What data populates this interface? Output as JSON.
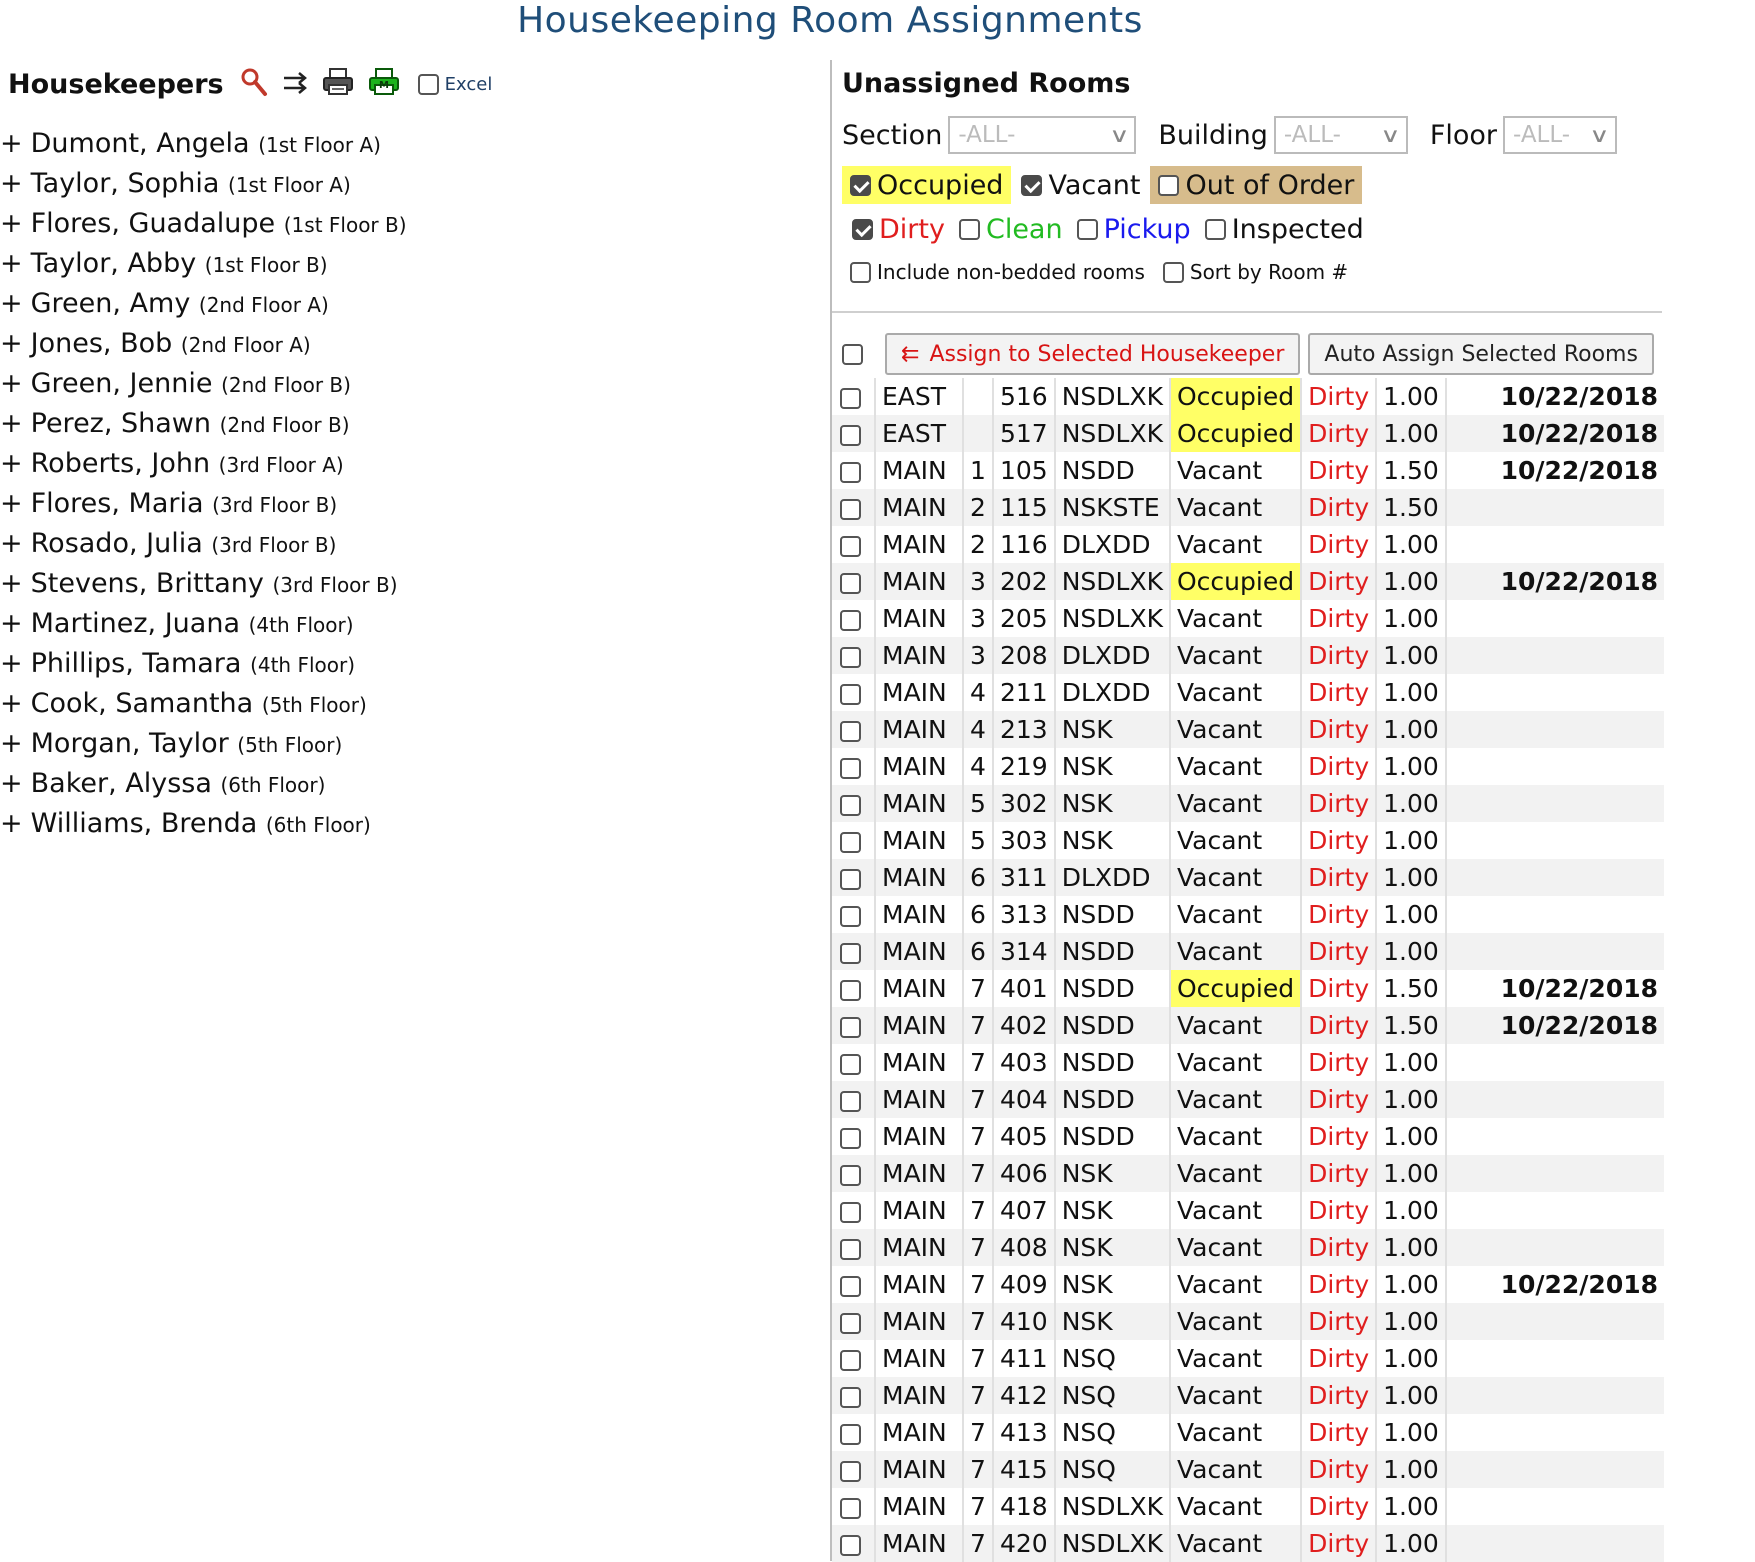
{
  "page_title": "Housekeeping Room Assignments",
  "housekeepers_panel": {
    "title": "Housekeepers",
    "icons": [
      "search-icon",
      "transfer-icon",
      "print-icon",
      "excel-print-icon"
    ],
    "excel_label": "Excel",
    "excel_checked": false,
    "items": [
      {
        "name": "Dumont, Angela",
        "area": "(1st Floor A)"
      },
      {
        "name": "Taylor, Sophia",
        "area": "(1st Floor A)"
      },
      {
        "name": "Flores, Guadalupe",
        "area": "(1st Floor B)"
      },
      {
        "name": "Taylor, Abby",
        "area": "(1st Floor B)"
      },
      {
        "name": "Green, Amy",
        "area": "(2nd Floor A)"
      },
      {
        "name": "Jones, Bob",
        "area": "(2nd Floor A)"
      },
      {
        "name": "Green, Jennie",
        "area": "(2nd Floor B)"
      },
      {
        "name": "Perez, Shawn",
        "area": "(2nd Floor B)"
      },
      {
        "name": "Roberts, John",
        "area": "(3rd Floor A)"
      },
      {
        "name": "Flores, Maria",
        "area": "(3rd Floor B)"
      },
      {
        "name": "Rosado, Julia",
        "area": "(3rd Floor B)"
      },
      {
        "name": "Stevens, Brittany",
        "area": "(3rd Floor B)"
      },
      {
        "name": "Martinez, Juana",
        "area": "(4th Floor)"
      },
      {
        "name": "Phillips, Tamara",
        "area": "(4th Floor)"
      },
      {
        "name": "Cook, Samantha",
        "area": "(5th Floor)"
      },
      {
        "name": "Morgan, Taylor",
        "area": "(5th Floor)"
      },
      {
        "name": "Baker, Alyssa",
        "area": "(6th Floor)"
      },
      {
        "name": "Williams, Brenda",
        "area": "(6th Floor)"
      }
    ]
  },
  "unassigned_panel": {
    "title": "Unassigned Rooms",
    "filters": {
      "section_label": "Section",
      "section_value": "-ALL-",
      "building_label": "Building",
      "building_value": "-ALL-",
      "floor_label": "Floor",
      "floor_value": "-ALL-"
    },
    "status_filters": {
      "occupied": {
        "label": "Occupied",
        "checked": true,
        "bg": "#ffff66"
      },
      "vacant": {
        "label": "Vacant",
        "checked": true
      },
      "out_of_order": {
        "label": "Out of Order",
        "checked": false,
        "bg": "#d7bc8c"
      }
    },
    "condition_filters": {
      "dirty": {
        "label": "Dirty",
        "checked": true,
        "color": "#e01e1e"
      },
      "clean": {
        "label": "Clean",
        "checked": false,
        "color": "#22bb22"
      },
      "pickup": {
        "label": "Pickup",
        "checked": false,
        "color": "#1a1aee"
      },
      "inspected": {
        "label": "Inspected",
        "checked": false
      }
    },
    "options": {
      "non_bedded": "Include non-bedded rooms",
      "sort_by_room": "Sort by Room #"
    },
    "buttons": {
      "assign_arrow": "⇇",
      "assign": "Assign to Selected Housekeeper",
      "auto_assign": "Auto Assign Selected Rooms"
    },
    "rooms": [
      {
        "section": "EAST",
        "floor": "",
        "room": "516",
        "type": "NSDLXK",
        "status": "Occupied",
        "condition": "Dirty",
        "credits": "1.00",
        "date": "10/22/2018"
      },
      {
        "section": "EAST",
        "floor": "",
        "room": "517",
        "type": "NSDLXK",
        "status": "Occupied",
        "condition": "Dirty",
        "credits": "1.00",
        "date": "10/22/2018"
      },
      {
        "section": "MAIN",
        "floor": "1",
        "room": "105",
        "type": "NSDD",
        "status": "Vacant",
        "condition": "Dirty",
        "credits": "1.50",
        "date": "10/22/2018"
      },
      {
        "section": "MAIN",
        "floor": "2",
        "room": "115",
        "type": "NSKSTE",
        "status": "Vacant",
        "condition": "Dirty",
        "credits": "1.50",
        "date": ""
      },
      {
        "section": "MAIN",
        "floor": "2",
        "room": "116",
        "type": "DLXDD",
        "status": "Vacant",
        "condition": "Dirty",
        "credits": "1.00",
        "date": ""
      },
      {
        "section": "MAIN",
        "floor": "3",
        "room": "202",
        "type": "NSDLXK",
        "status": "Occupied",
        "condition": "Dirty",
        "credits": "1.00",
        "date": "10/22/2018"
      },
      {
        "section": "MAIN",
        "floor": "3",
        "room": "205",
        "type": "NSDLXK",
        "status": "Vacant",
        "condition": "Dirty",
        "credits": "1.00",
        "date": ""
      },
      {
        "section": "MAIN",
        "floor": "3",
        "room": "208",
        "type": "DLXDD",
        "status": "Vacant",
        "condition": "Dirty",
        "credits": "1.00",
        "date": ""
      },
      {
        "section": "MAIN",
        "floor": "4",
        "room": "211",
        "type": "DLXDD",
        "status": "Vacant",
        "condition": "Dirty",
        "credits": "1.00",
        "date": ""
      },
      {
        "section": "MAIN",
        "floor": "4",
        "room": "213",
        "type": "NSK",
        "status": "Vacant",
        "condition": "Dirty",
        "credits": "1.00",
        "date": ""
      },
      {
        "section": "MAIN",
        "floor": "4",
        "room": "219",
        "type": "NSK",
        "status": "Vacant",
        "condition": "Dirty",
        "credits": "1.00",
        "date": ""
      },
      {
        "section": "MAIN",
        "floor": "5",
        "room": "302",
        "type": "NSK",
        "status": "Vacant",
        "condition": "Dirty",
        "credits": "1.00",
        "date": ""
      },
      {
        "section": "MAIN",
        "floor": "5",
        "room": "303",
        "type": "NSK",
        "status": "Vacant",
        "condition": "Dirty",
        "credits": "1.00",
        "date": ""
      },
      {
        "section": "MAIN",
        "floor": "6",
        "room": "311",
        "type": "DLXDD",
        "status": "Vacant",
        "condition": "Dirty",
        "credits": "1.00",
        "date": ""
      },
      {
        "section": "MAIN",
        "floor": "6",
        "room": "313",
        "type": "NSDD",
        "status": "Vacant",
        "condition": "Dirty",
        "credits": "1.00",
        "date": ""
      },
      {
        "section": "MAIN",
        "floor": "6",
        "room": "314",
        "type": "NSDD",
        "status": "Vacant",
        "condition": "Dirty",
        "credits": "1.00",
        "date": ""
      },
      {
        "section": "MAIN",
        "floor": "7",
        "room": "401",
        "type": "NSDD",
        "status": "Occupied",
        "condition": "Dirty",
        "credits": "1.50",
        "date": "10/22/2018"
      },
      {
        "section": "MAIN",
        "floor": "7",
        "room": "402",
        "type": "NSDD",
        "status": "Vacant",
        "condition": "Dirty",
        "credits": "1.50",
        "date": "10/22/2018"
      },
      {
        "section": "MAIN",
        "floor": "7",
        "room": "403",
        "type": "NSDD",
        "status": "Vacant",
        "condition": "Dirty",
        "credits": "1.00",
        "date": ""
      },
      {
        "section": "MAIN",
        "floor": "7",
        "room": "404",
        "type": "NSDD",
        "status": "Vacant",
        "condition": "Dirty",
        "credits": "1.00",
        "date": ""
      },
      {
        "section": "MAIN",
        "floor": "7",
        "room": "405",
        "type": "NSDD",
        "status": "Vacant",
        "condition": "Dirty",
        "credits": "1.00",
        "date": ""
      },
      {
        "section": "MAIN",
        "floor": "7",
        "room": "406",
        "type": "NSK",
        "status": "Vacant",
        "condition": "Dirty",
        "credits": "1.00",
        "date": ""
      },
      {
        "section": "MAIN",
        "floor": "7",
        "room": "407",
        "type": "NSK",
        "status": "Vacant",
        "condition": "Dirty",
        "credits": "1.00",
        "date": ""
      },
      {
        "section": "MAIN",
        "floor": "7",
        "room": "408",
        "type": "NSK",
        "status": "Vacant",
        "condition": "Dirty",
        "credits": "1.00",
        "date": ""
      },
      {
        "section": "MAIN",
        "floor": "7",
        "room": "409",
        "type": "NSK",
        "status": "Vacant",
        "condition": "Dirty",
        "credits": "1.00",
        "date": "10/22/2018"
      },
      {
        "section": "MAIN",
        "floor": "7",
        "room": "410",
        "type": "NSK",
        "status": "Vacant",
        "condition": "Dirty",
        "credits": "1.00",
        "date": ""
      },
      {
        "section": "MAIN",
        "floor": "7",
        "room": "411",
        "type": "NSQ",
        "status": "Vacant",
        "condition": "Dirty",
        "credits": "1.00",
        "date": ""
      },
      {
        "section": "MAIN",
        "floor": "7",
        "room": "412",
        "type": "NSQ",
        "status": "Vacant",
        "condition": "Dirty",
        "credits": "1.00",
        "date": ""
      },
      {
        "section": "MAIN",
        "floor": "7",
        "room": "413",
        "type": "NSQ",
        "status": "Vacant",
        "condition": "Dirty",
        "credits": "1.00",
        "date": ""
      },
      {
        "section": "MAIN",
        "floor": "7",
        "room": "415",
        "type": "NSQ",
        "status": "Vacant",
        "condition": "Dirty",
        "credits": "1.00",
        "date": ""
      },
      {
        "section": "MAIN",
        "floor": "7",
        "room": "418",
        "type": "NSDLXK",
        "status": "Vacant",
        "condition": "Dirty",
        "credits": "1.00",
        "date": ""
      },
      {
        "section": "MAIN",
        "floor": "7",
        "room": "420",
        "type": "NSDLXK",
        "status": "Vacant",
        "condition": "Dirty",
        "credits": "1.00",
        "date": ""
      }
    ]
  }
}
